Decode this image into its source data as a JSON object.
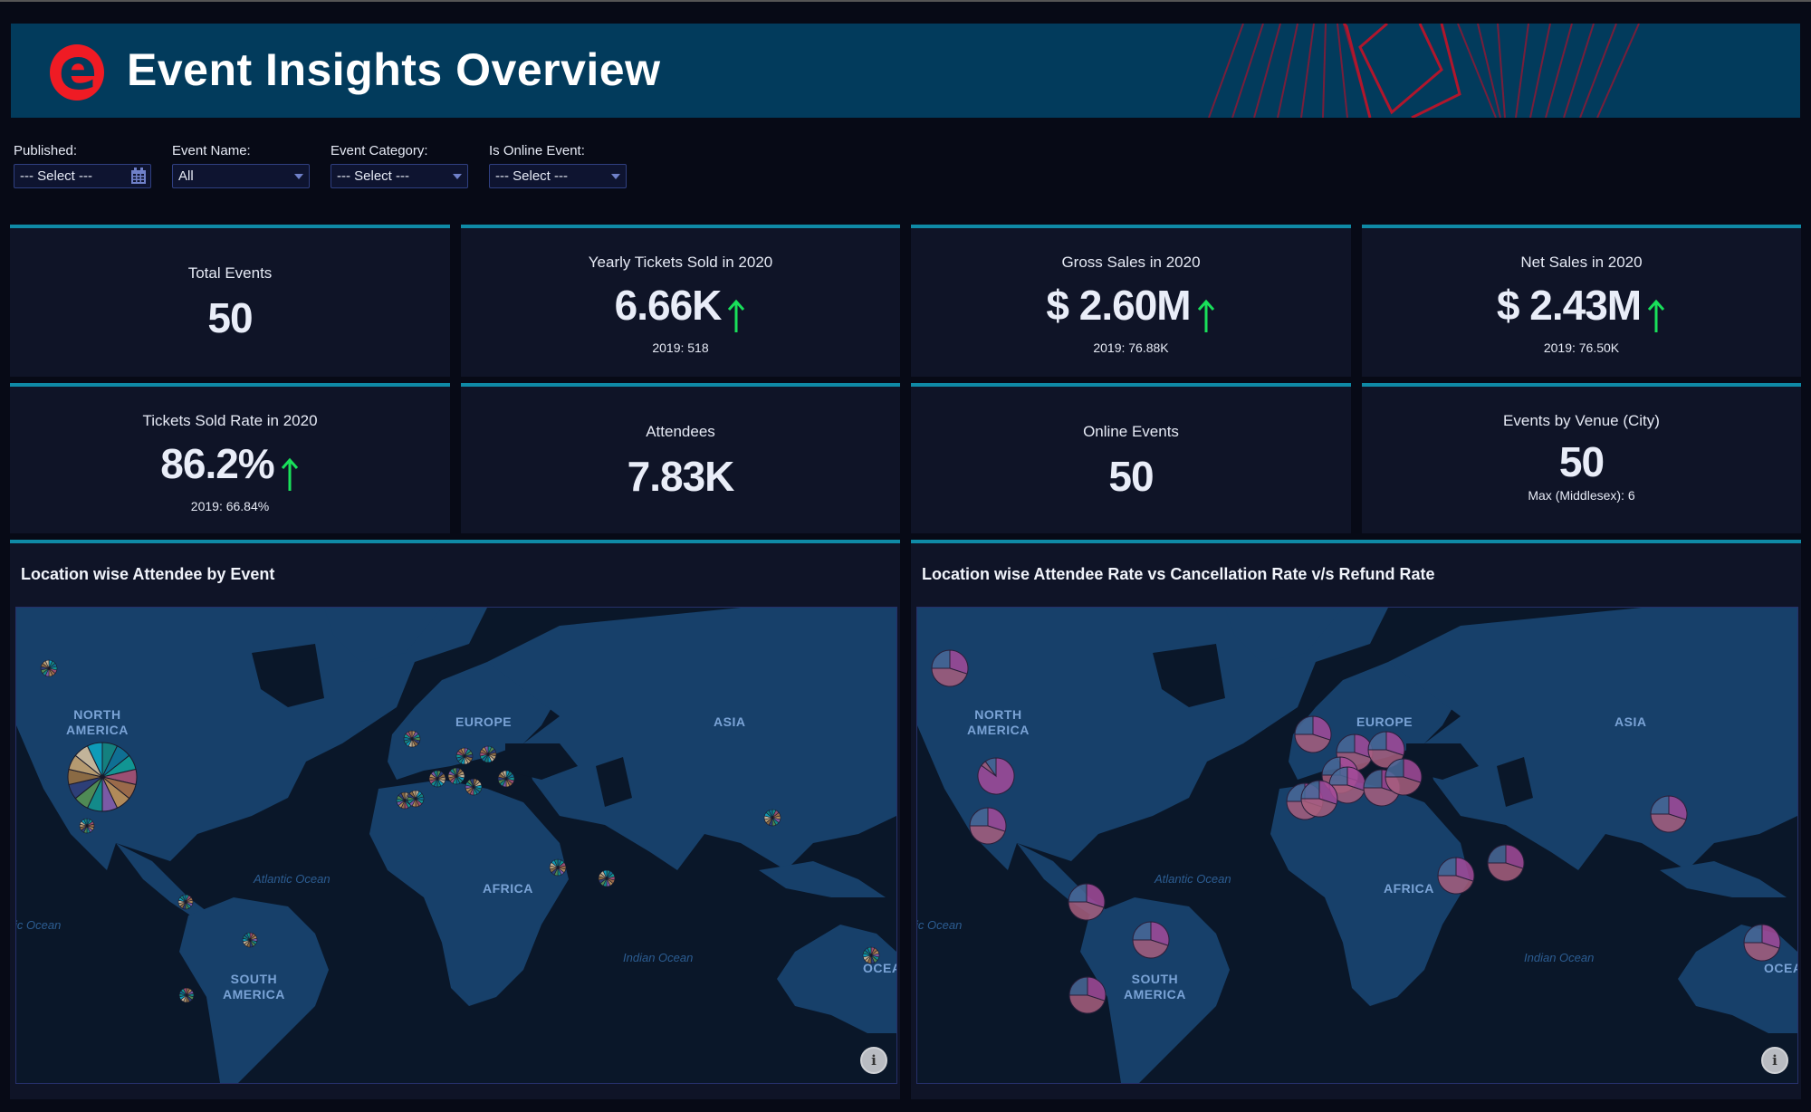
{
  "header": {
    "title": "Event Insights Overview",
    "logo_letter": "e",
    "brand_color": "#ef1b24"
  },
  "filters": [
    {
      "label": "Published:",
      "value": "--- Select ---",
      "control": "date",
      "icon": "calendar-icon"
    },
    {
      "label": "Event Name:",
      "value": "All",
      "control": "dropdown"
    },
    {
      "label": "Event Category:",
      "value": "--- Select ---",
      "control": "dropdown"
    },
    {
      "label": "Is Online Event:",
      "value": "--- Select ---",
      "control": "dropdown"
    }
  ],
  "kpis": [
    {
      "title": "Total Events",
      "value": "50"
    },
    {
      "title": "Yearly Tickets Sold in 2020",
      "value": "6.66K",
      "trend": "up",
      "sub": "2019: 518"
    },
    {
      "title": "Gross Sales in 2020",
      "value": "$ 2.60M",
      "trend": "up",
      "sub": "2019: 76.88K"
    },
    {
      "title": "Net Sales in 2020",
      "value": "$ 2.43M",
      "trend": "up",
      "sub": "2019: 76.50K"
    },
    {
      "title": "Tickets Sold Rate in 2020",
      "value": "86.2%",
      "trend": "up",
      "sub": "2019: 66.84%"
    },
    {
      "title": "Attendees",
      "value": "7.83K"
    },
    {
      "title": "Online Events",
      "value": "50"
    },
    {
      "title": "Events by Venue (City)",
      "value": "50",
      "sub": "Max (Middlesex): 6"
    }
  ],
  "colors": {
    "accent": "#0f8aa6",
    "trend_up": "#19e05a",
    "land": "#17406a",
    "sea": "#0a1729"
  },
  "panels": [
    {
      "title": "Location wise Attendee by Event",
      "regions": [
        "NORTH AMERICA",
        "EUROPE",
        "ASIA",
        "AFRICA",
        "SOUTH AMERICA",
        "OCEANIA"
      ],
      "oceans": [
        "Atlantic Ocean",
        "Indian Ocean",
        "Pacific Ocean"
      ],
      "pie_palette": [
        "#0e9bb8",
        "#14807f",
        "#0f6f93",
        "#119593",
        "#9a4f72",
        "#9a6a4a",
        "#b08a5a",
        "#7a5aa6",
        "#138a8a",
        "#4f8a55",
        "#2d3f78",
        "#8a6a44",
        "#b59a70",
        "#c2b49a"
      ]
    },
    {
      "title": "Location wise Attendee Rate vs Cancellation Rate v/s Refund Rate",
      "regions": [
        "NORTH AMERICA",
        "EUROPE",
        "ASIA",
        "AFRICA",
        "SOUTH AMERICA",
        "OCEANIA"
      ],
      "oceans": [
        "Atlantic Ocean",
        "Indian Ocean",
        "Pacific Ocean"
      ],
      "pie_palette": [
        "#a54b9a",
        "#a85f7e",
        "#4a6a99"
      ]
    }
  ]
}
